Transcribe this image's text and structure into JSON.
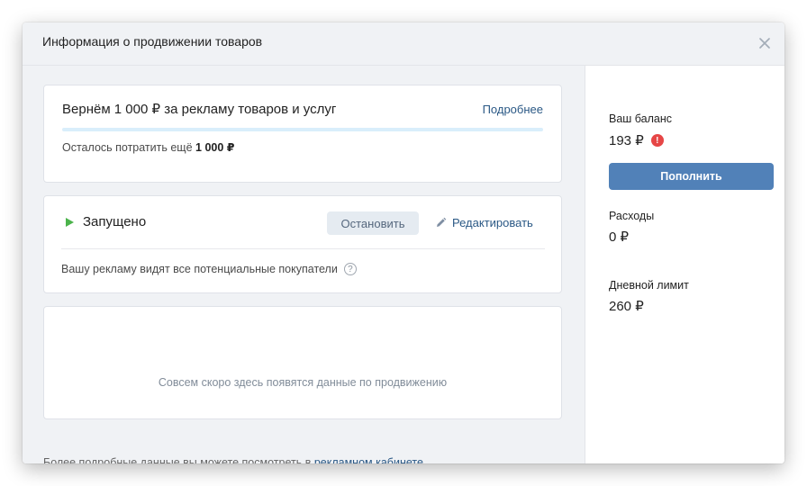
{
  "modal": {
    "title": "Информация о продвижении товаров"
  },
  "cashback": {
    "title": "Вернём 1 000 ₽ за рекламу товаров и услуг",
    "more_link": "Подробнее",
    "remaining_prefix": "Осталось потратить ещё ",
    "remaining_amount": "1 000 ₽",
    "progress": 0
  },
  "campaign": {
    "status": "Запущено",
    "stop_button": "Остановить",
    "edit_link": "Редактировать",
    "info": "Вашу рекламу видят все потенциальные покупатели",
    "help_icon": "?"
  },
  "stats": {
    "empty_text": "Совсем скоро здесь появятся данные по продвижению"
  },
  "footer": {
    "text": "Более подробные данные вы можете посмотреть в ",
    "link": "рекламном кабинете"
  },
  "sidebar": {
    "balance_label": "Ваш баланс",
    "balance_value": "193 ₽",
    "warning_icon": "!",
    "topup_button": "Пополнить",
    "expenses_label": "Расходы",
    "expenses_value": "0 ₽",
    "daily_limit_label": "Дневной лимит",
    "daily_limit_value": "260 ₽"
  },
  "icons": {
    "close": "close-icon",
    "play": "play-icon",
    "pencil": "pencil-icon",
    "help": "question-icon",
    "warning": "warning-icon"
  },
  "colors": {
    "accent": "#5181b8",
    "link": "#2a5885",
    "status_green": "#4bb34b",
    "warning_red": "#e64646",
    "progress_track": "#d9eefb"
  }
}
